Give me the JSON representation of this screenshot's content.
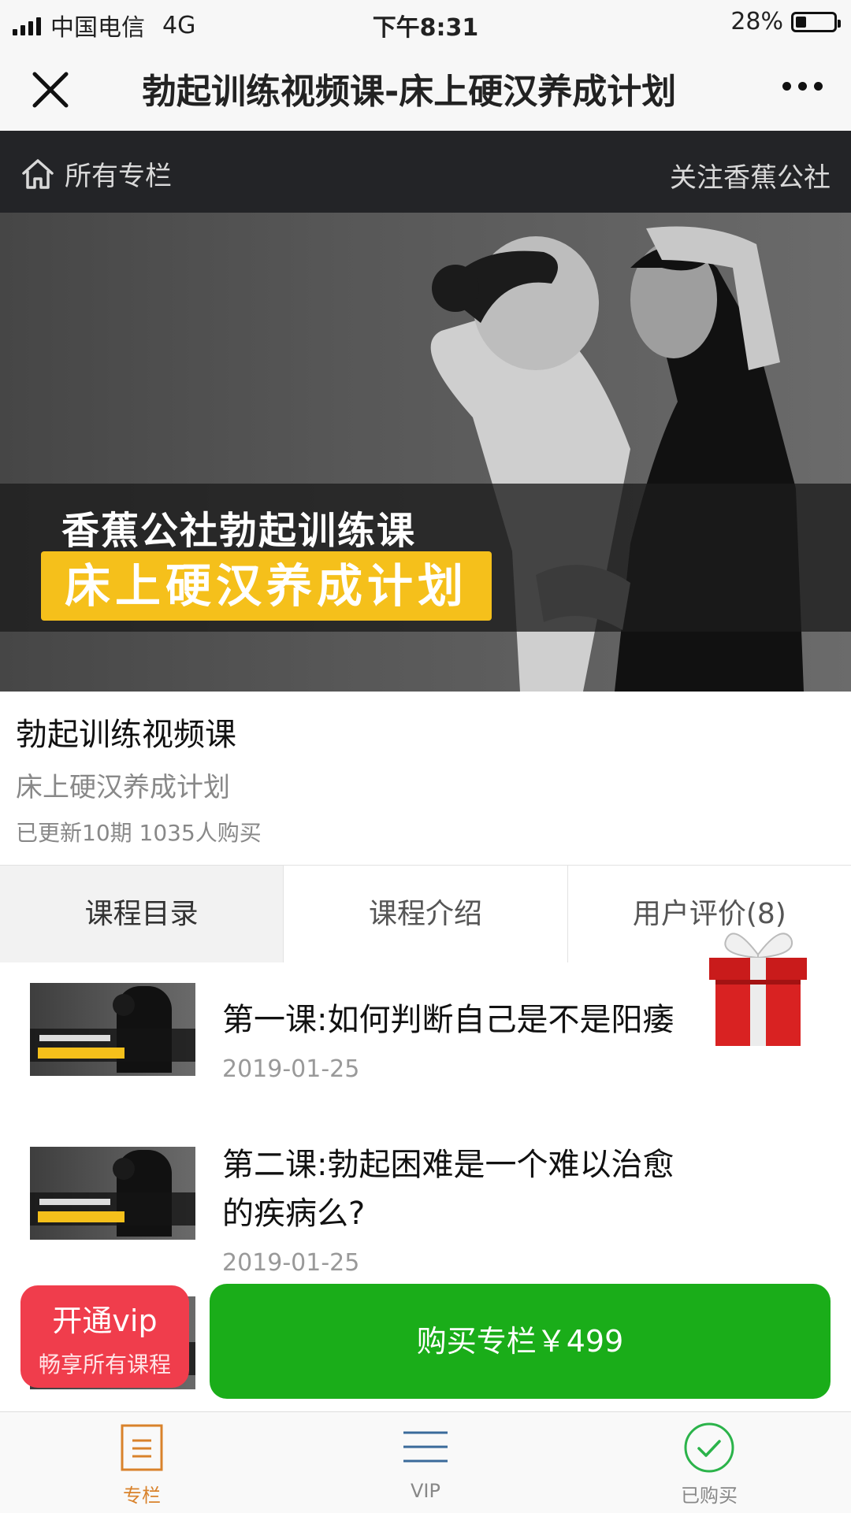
{
  "status_bar": {
    "carrier": "中国电信",
    "network": "4G",
    "time": "下午8:31",
    "battery_percent": "28%",
    "battery_level": 0.28
  },
  "navbar": {
    "title": "勃起训练视频课-床上硬汉养成计划",
    "close_icon": "close-icon",
    "more_icon": "more-icon"
  },
  "column_bar": {
    "all_columns": "所有专栏",
    "follow": "关注香蕉公社"
  },
  "banner": {
    "line1": "香蕉公社勃起训练课",
    "line2": "床上硬汉养成计划",
    "accent_color": "#f5c01b"
  },
  "course": {
    "title": "勃起训练视频课",
    "subtitle": "床上硬汉养成计划",
    "meta": "已更新10期 1035人购买"
  },
  "tabs": [
    {
      "label": "课程目录",
      "active": true
    },
    {
      "label": "课程介绍",
      "active": false
    },
    {
      "label": "用户评价(8)",
      "active": false
    }
  ],
  "lessons": [
    {
      "title": "第一课:如何判断自己是不是阳痿",
      "date": "2019-01-25"
    },
    {
      "title": "第二课:勃起困难是一个难以治愈的疾病么?",
      "date": "2019-01-25"
    }
  ],
  "actions": {
    "vip_main": "开通vip",
    "vip_sub": "畅享所有课程",
    "buy": "购买专栏￥499",
    "buy_color": "#1aad19",
    "vip_color": "#f03d4c"
  },
  "tabbar": [
    {
      "label": "专栏",
      "icon": "column-icon",
      "active": true
    },
    {
      "label": "VIP",
      "icon": "menu-icon",
      "active": false
    },
    {
      "label": "已购买",
      "icon": "check-circle-icon",
      "active": false
    }
  ]
}
